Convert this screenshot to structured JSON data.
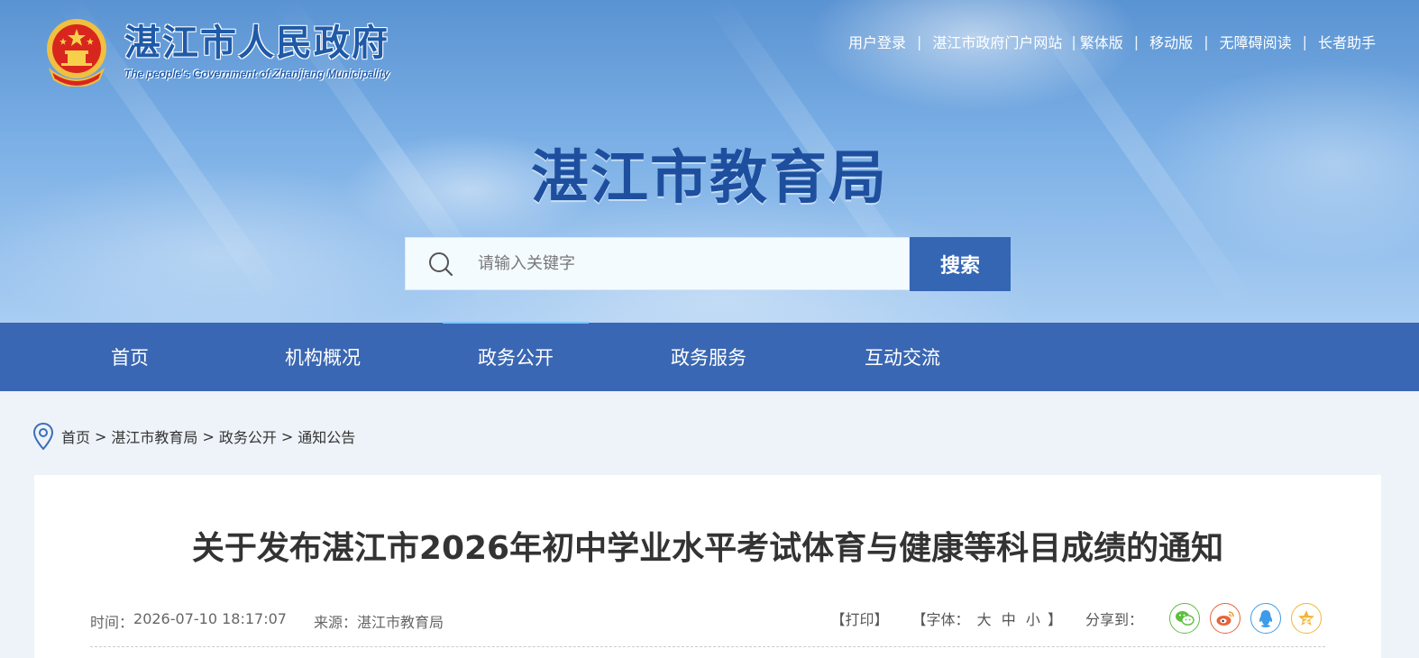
{
  "header": {
    "gov_title": "湛江市人民政府",
    "gov_subtitle": "The people's Government of Zhanjiang Municipality",
    "dept_title": "湛江市教育局",
    "top_links": [
      "用户登录",
      "湛江市政府门户网站",
      "繁体版",
      "移动版",
      "无障碍阅读",
      "长者助手"
    ]
  },
  "search": {
    "placeholder": "请输入关键字",
    "button_label": "搜索"
  },
  "nav": {
    "items": [
      "首页",
      "机构概况",
      "政务公开",
      "政务服务",
      "互动交流"
    ],
    "active": "政务公开"
  },
  "breadcrumb": {
    "items": [
      "首页",
      "湛江市教育局",
      "政务公开",
      "通知公告"
    ],
    "separator": ">"
  },
  "article": {
    "title": "关于发布湛江市2026年初中学业水平考试体育与健康等科目成绩的通知",
    "time_label": "时间：",
    "time_value": "2026-07-10 18:17:07",
    "source_label": "来源：",
    "source_value": "湛江市教育局",
    "print_label": "【打印】",
    "font_prefix": "【字体：",
    "font_large": "大",
    "font_medium": "中",
    "font_small": "小",
    "font_suffix": "】",
    "share_label": "分享到："
  },
  "share_icons": [
    {
      "name": "wechat-icon",
      "color": "#5cbf3f"
    },
    {
      "name": "weibo-icon",
      "color": "#e8633b"
    },
    {
      "name": "qq-icon",
      "color": "#3d9be9"
    },
    {
      "name": "qzone-icon",
      "color": "#f2b536"
    }
  ],
  "colors": {
    "primary": "#3a67b3",
    "dept_title": "#1e4f9e",
    "search_button": "#3566b4"
  }
}
